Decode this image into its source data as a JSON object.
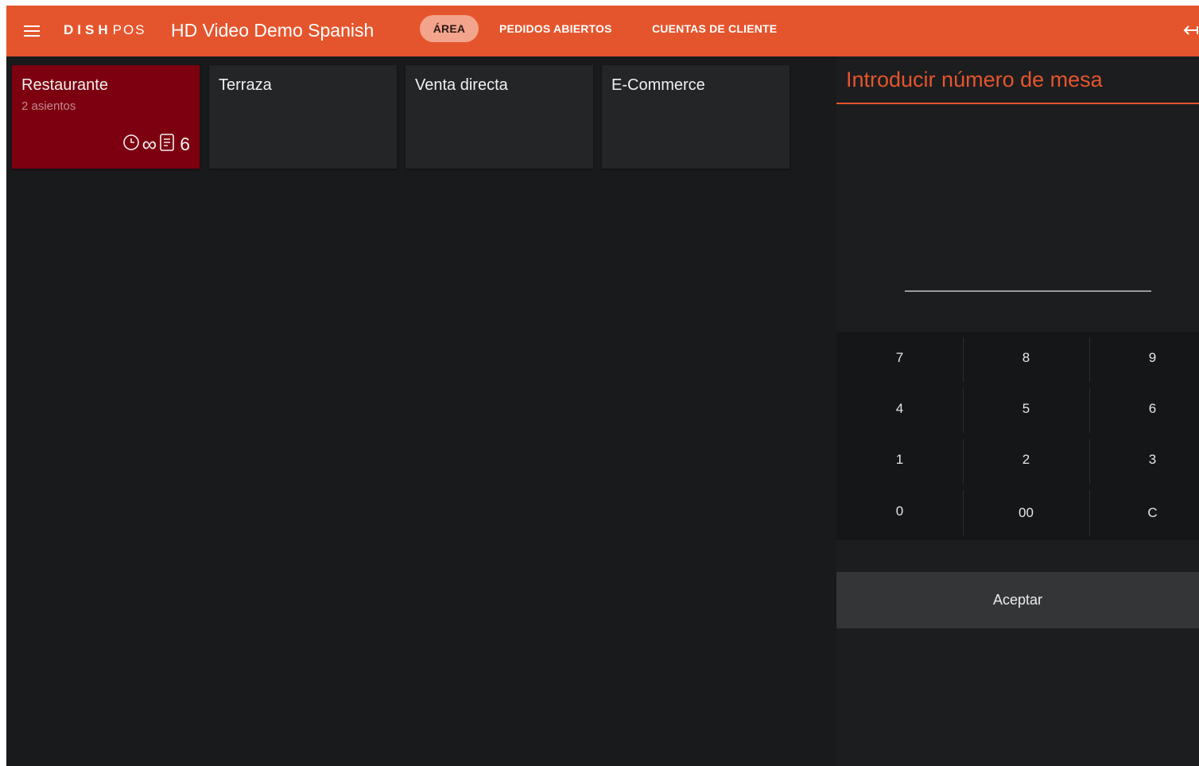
{
  "header": {
    "logo_bold": "DISH",
    "logo_light": "POS",
    "title": "HD Video Demo Spanish",
    "brand_color": "#e5552d"
  },
  "tabs": [
    {
      "label": "ÁREA",
      "active": true
    },
    {
      "label": "PEDIDOS ABIERTOS",
      "active": false
    },
    {
      "label": "CUENTAS DE CLIENTE",
      "active": false
    }
  ],
  "areas": [
    {
      "name": "Restaurante",
      "seats": "2 asientos",
      "time": "∞",
      "orders": "6",
      "active": true
    },
    {
      "name": "Terraza",
      "active": false
    },
    {
      "name": "Venta directa",
      "active": false
    },
    {
      "name": "E-Commerce",
      "active": false
    }
  ],
  "panel": {
    "title": "Introducir número de mesa",
    "input_value": "",
    "keys": [
      "7",
      "8",
      "9",
      "4",
      "5",
      "6",
      "1",
      "2",
      "3",
      "0",
      "00",
      "C"
    ],
    "accept_label": "Aceptar"
  },
  "icons": {
    "menu": "menu-icon",
    "exit": "exit-icon",
    "clock": "clock-icon",
    "receipt": "receipt-icon"
  }
}
